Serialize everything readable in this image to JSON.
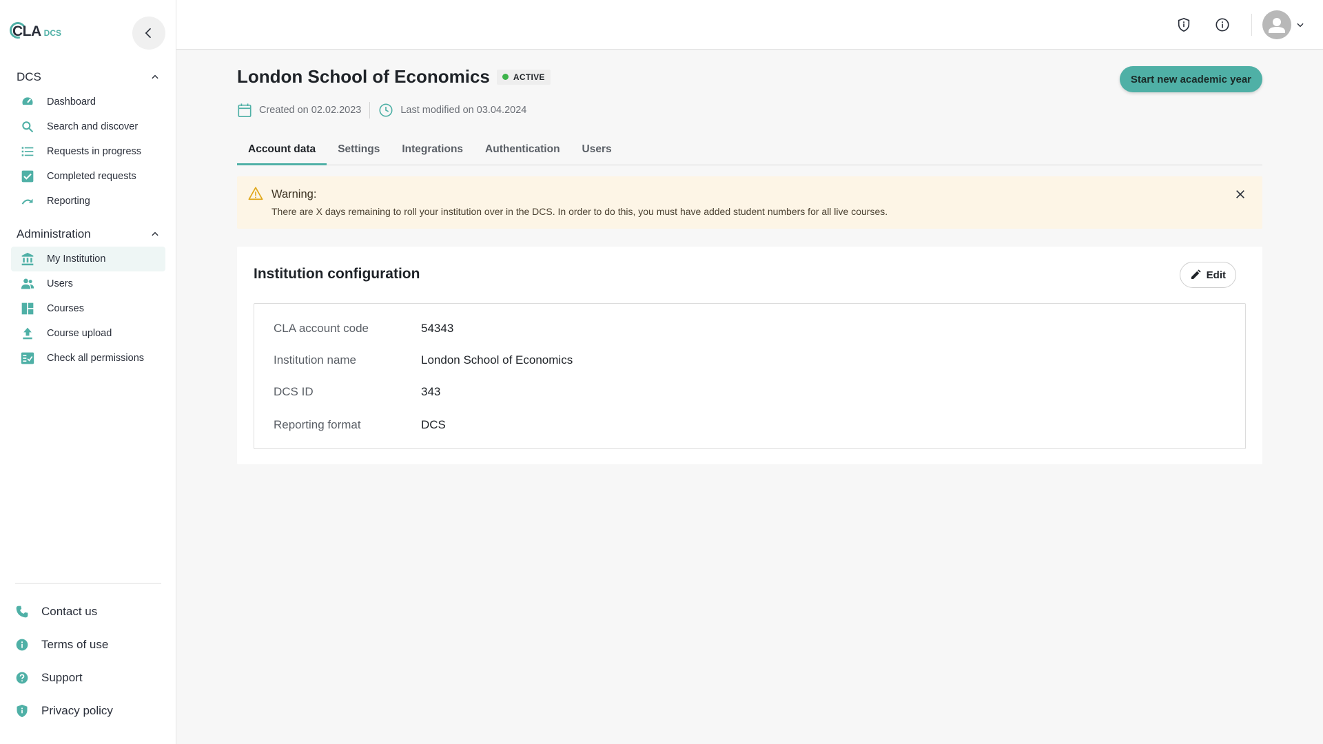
{
  "logo": {
    "main": "CLA",
    "sub": "DCS"
  },
  "sidebar": {
    "section_dcs": "DCS",
    "dcs_items": [
      {
        "label": "Dashboard",
        "icon": "dashboard-icon"
      },
      {
        "label": "Search and discover",
        "icon": "search-icon"
      },
      {
        "label": "Requests in progress",
        "icon": "list-icon"
      },
      {
        "label": "Completed requests",
        "icon": "checkbox-icon"
      },
      {
        "label": "Reporting",
        "icon": "redo-icon"
      }
    ],
    "section_admin": "Administration",
    "admin_items": [
      {
        "label": "My Institution",
        "icon": "bank-icon",
        "active": true
      },
      {
        "label": "Users",
        "icon": "users-icon"
      },
      {
        "label": "Courses",
        "icon": "courses-icon"
      },
      {
        "label": "Course upload",
        "icon": "upload-icon"
      },
      {
        "label": "Check all permissions",
        "icon": "checklist-icon"
      }
    ],
    "footer": [
      {
        "label": "Contact us",
        "icon": "phone-icon"
      },
      {
        "label": "Terms of use",
        "icon": "info-circle-icon"
      },
      {
        "label": "Support",
        "icon": "help-icon"
      },
      {
        "label": "Privacy policy",
        "icon": "shield-icon"
      }
    ]
  },
  "page": {
    "title": "London School of Economics",
    "status": "ACTIVE",
    "primary_action": "Start new academic year",
    "created": "Created on 02.02.2023",
    "modified": "Last modified on 03.04.2024"
  },
  "tabs": [
    "Account data",
    "Settings",
    "Integrations",
    "Authentication",
    "Users"
  ],
  "warning": {
    "title": "Warning:",
    "text": "There are X days remaining to roll your institution over in the DCS. In order to do this, you must have added student numbers for all live courses."
  },
  "card": {
    "title": "Institution configuration",
    "edit_label": "Edit",
    "rows": [
      {
        "label": "CLA account code",
        "value": "54343"
      },
      {
        "label": "Institution name",
        "value": "London School of Economics"
      },
      {
        "label": "DCS ID",
        "value": "343"
      },
      {
        "label": "Reporting format",
        "value": "DCS"
      }
    ]
  },
  "colors": {
    "accent": "#4fb0a6",
    "warning_bg": "#fdf5e6",
    "status_green": "#3cb34a"
  }
}
